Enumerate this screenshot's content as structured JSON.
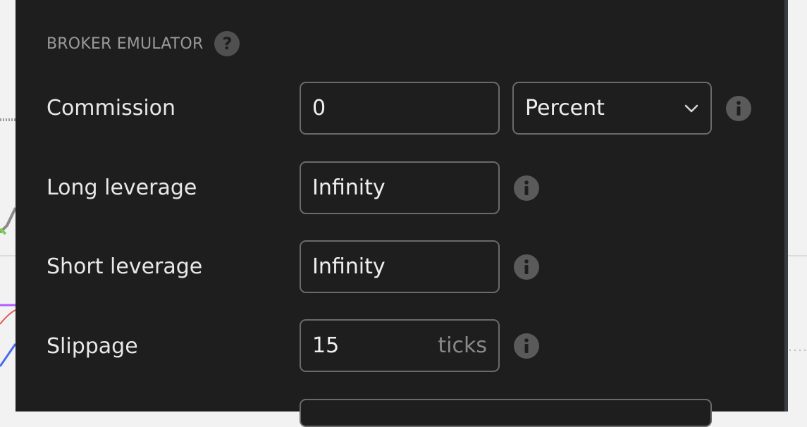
{
  "section": {
    "title": "BROKER EMULATOR",
    "help_icon": "question-circle-icon"
  },
  "rows": [
    {
      "label": "Commission",
      "value": "0",
      "select": "Percent"
    },
    {
      "label": "Long leverage",
      "value": "Infinity"
    },
    {
      "label": "Short leverage",
      "value": "Infinity"
    },
    {
      "label": "Slippage",
      "value": "15",
      "unit": "ticks"
    }
  ],
  "icons": {
    "info": "info-circle-icon",
    "dropdown": "chevron-down-icon"
  },
  "colors": {
    "dialog_bg": "#1e1e1e",
    "field_border": "#6a6a6a",
    "text": "#e8e8e8",
    "muted": "#9a9a9a"
  }
}
